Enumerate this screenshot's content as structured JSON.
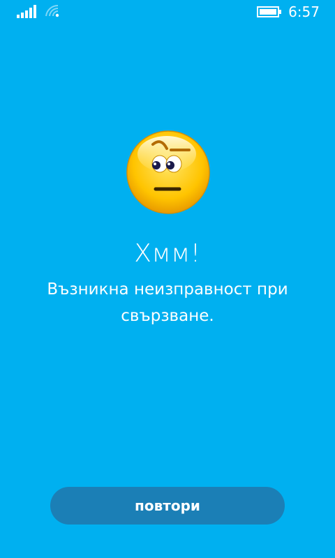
{
  "status_bar": {
    "time": "6:57",
    "icons": [
      "signal-icon",
      "wifi-icon",
      "battery-icon"
    ]
  },
  "emoticon": {
    "icon": "skeptical-emoticon-icon"
  },
  "error": {
    "title": "Хмм!",
    "message": "Възникна неизправност при свързване."
  },
  "actions": {
    "retry_label": "повтори"
  },
  "colors": {
    "background": "#00b0f0",
    "button": "#1b7fb6",
    "text": "#ffffff"
  }
}
